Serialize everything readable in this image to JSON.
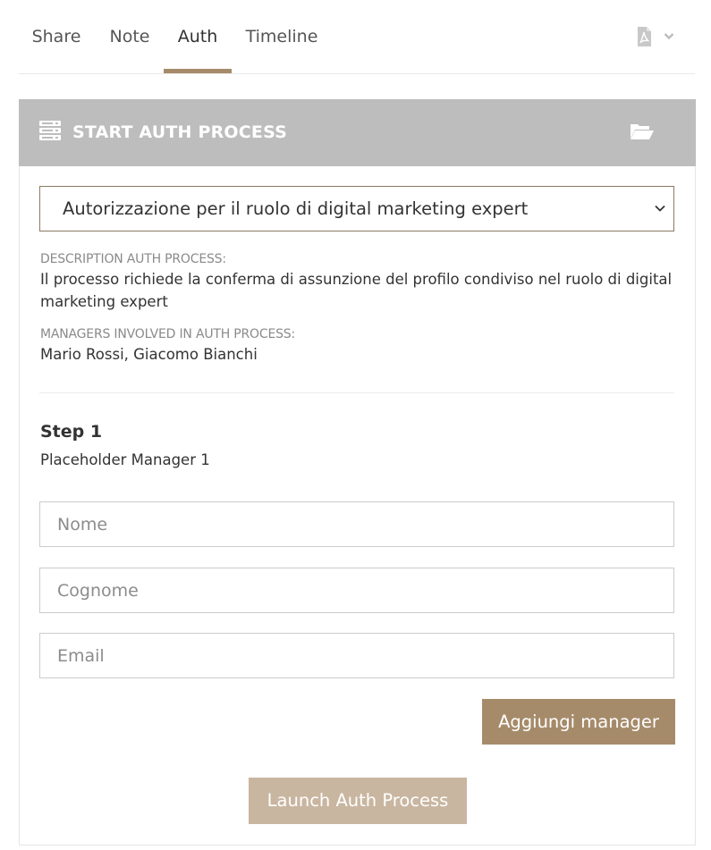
{
  "tabs": {
    "share": "Share",
    "note": "Note",
    "auth": "Auth",
    "timeline": "Timeline",
    "active": "auth"
  },
  "toolbar": {
    "export_icon": "pdf-file-icon",
    "export_dropdown_icon": "chevron-down-icon"
  },
  "panel": {
    "header_icon": "list-icon",
    "title": "START AUTH PROCESS",
    "folder_icon": "folder-open-icon",
    "header_color": "#bdbdbd",
    "select": {
      "selected": "Autorizzazione per il ruolo di digital marketing expert"
    },
    "description_label": "DESCRIPTION AUTH PROCESS:",
    "description_value": "Il processo richiede la conferma di assunzione del profilo condiviso nel ruolo di digital marketing expert",
    "managers_label": "MANAGERS INVOLVED IN AUTH PROCESS:",
    "managers_value": "Mario Rossi, Giacomo Bianchi"
  },
  "step": {
    "title": "Step 1",
    "subtitle": "Placeholder Manager 1",
    "fields": {
      "nome": {
        "placeholder": "Nome",
        "value": ""
      },
      "cognome": {
        "placeholder": "Cognome",
        "value": ""
      },
      "email": {
        "placeholder": "Email",
        "value": ""
      }
    }
  },
  "buttons": {
    "add_manager": "Aggiungi manager",
    "launch": "Launch Auth Process"
  },
  "colors": {
    "accent": "#a68b6a",
    "launch_button": "#c9b6a0"
  }
}
